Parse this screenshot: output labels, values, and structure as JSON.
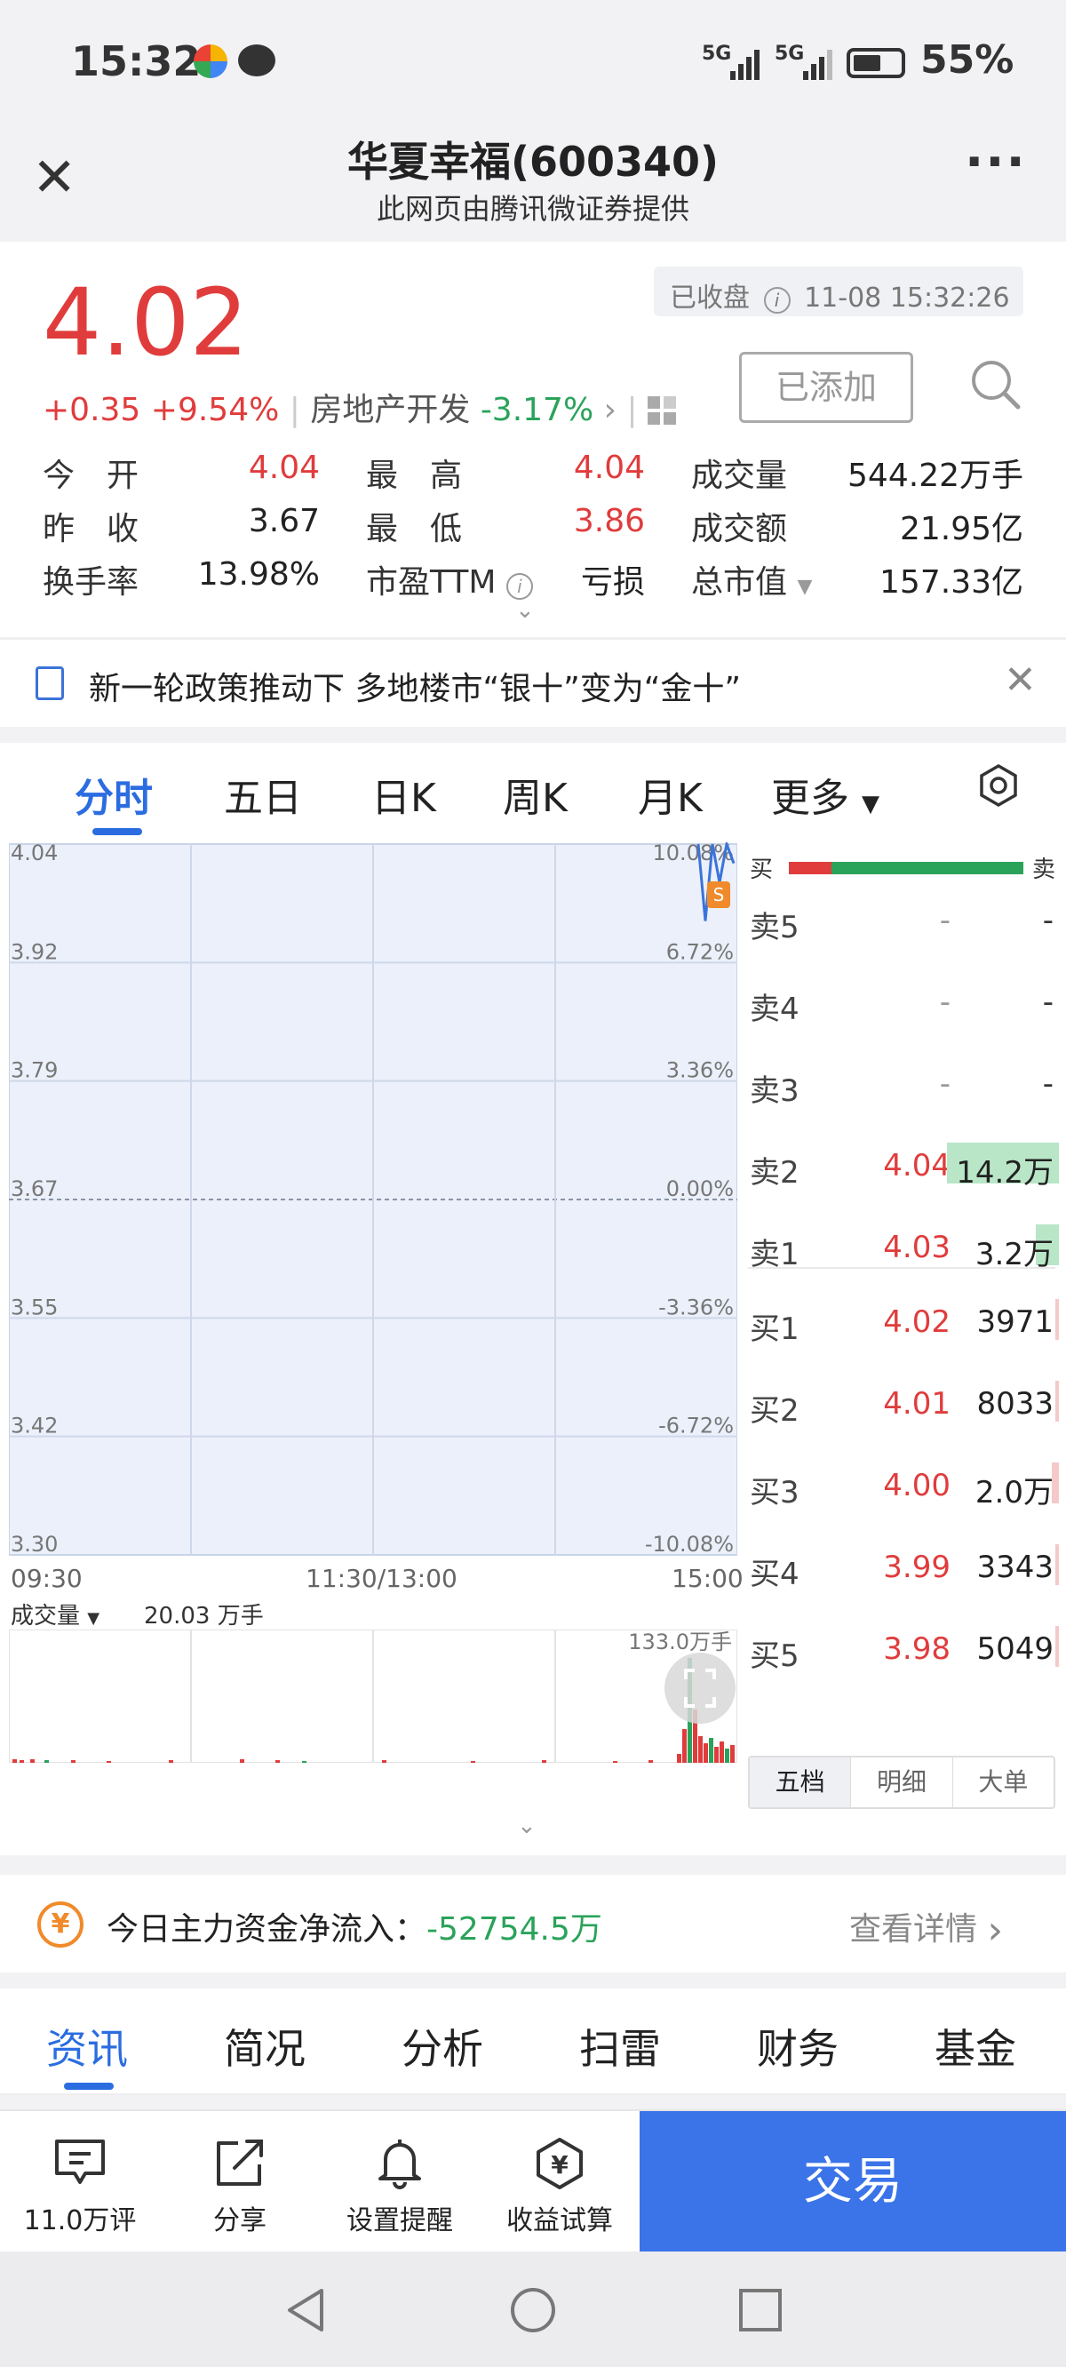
{
  "status_bar": {
    "time": "15:32",
    "signal1": "5G",
    "signal2": "5G",
    "battery": "55%"
  },
  "title": {
    "name": "华夏幸福(600340)",
    "subtitle": "此网页由腾讯微证券提供"
  },
  "quote": {
    "price": "4.02",
    "status": "已收盘",
    "timestamp": "11-08 15:32:26",
    "change": "+0.35",
    "change_pct": "+9.54%",
    "sector": "房地产开发",
    "sector_pct": "-3.17%",
    "added_label": "已添加",
    "stats": [
      {
        "label": "今　开",
        "value": "4.04"
      },
      {
        "label": "最　高",
        "value": "4.04"
      },
      {
        "label": "成交量",
        "value": "544.22万手"
      },
      {
        "label": "昨　收",
        "value": "3.67"
      },
      {
        "label": "最　低",
        "value": "3.86"
      },
      {
        "label": "成交额",
        "value": "21.95亿"
      },
      {
        "label": "换手率",
        "value": "13.98%"
      },
      {
        "label": "市盈TTM",
        "value": "亏损"
      },
      {
        "label": "总市值",
        "value": "157.33亿"
      }
    ]
  },
  "news": {
    "headline": "新一轮政策推动下 多地楼市“银十”变为“金十”"
  },
  "chart_tabs": [
    "分时",
    "五日",
    "日K",
    "周K",
    "月K",
    "更多"
  ],
  "chart_data": {
    "type": "line",
    "title": "",
    "y_left_ticks": [
      "4.04",
      "3.92",
      "3.79",
      "3.67",
      "3.55",
      "3.42",
      "3.30"
    ],
    "y_right_ticks": [
      "10.08%",
      "6.72%",
      "3.36%",
      "0.00%",
      "-3.36%",
      "-6.72%",
      "-10.08%"
    ],
    "x_ticks": [
      "09:30",
      "11:30/13:00",
      "15:00"
    ],
    "ylim": [
      3.3,
      4.04
    ],
    "prev_close": 3.67,
    "series": [
      {
        "x": [
          "14:50",
          "14:52",
          "14:54",
          "14:56",
          "14:58",
          "15:00"
        ],
        "values": [
          4.04,
          3.96,
          4.04,
          4.0,
          4.04,
          4.02
        ]
      }
    ],
    "volume_label": "成交量",
    "volume_value": "20.03 万手",
    "volume_max": "133.0万手"
  },
  "order_book": {
    "buy_label": "买",
    "sell_label": "卖",
    "asks": [
      {
        "label": "卖5",
        "price": "-",
        "volume": "-"
      },
      {
        "label": "卖4",
        "price": "-",
        "volume": "-"
      },
      {
        "label": "卖3",
        "price": "-",
        "volume": "-"
      },
      {
        "label": "卖2",
        "price": "4.04",
        "volume": "14.2万"
      },
      {
        "label": "卖1",
        "price": "4.03",
        "volume": "3.2万"
      }
    ],
    "bids": [
      {
        "label": "买1",
        "price": "4.02",
        "volume": "3971"
      },
      {
        "label": "买2",
        "price": "4.01",
        "volume": "8033"
      },
      {
        "label": "买3",
        "price": "4.00",
        "volume": "2.0万"
      },
      {
        "label": "买4",
        "price": "3.99",
        "volume": "3343"
      },
      {
        "label": "买5",
        "price": "3.98",
        "volume": "5049"
      }
    ],
    "tabs": [
      "五档",
      "明细",
      "大单"
    ]
  },
  "fund_flow": {
    "label": "今日主力资金净流入：",
    "value": "-52754.5万",
    "detail": "查看详情"
  },
  "info_tabs": [
    "资讯",
    "简况",
    "分析",
    "扫雷",
    "财务",
    "基金"
  ],
  "toolbar": {
    "comments": "11.0万评",
    "share": "分享",
    "alert": "设置提醒",
    "calc": "收益试算",
    "trade": "交易"
  }
}
